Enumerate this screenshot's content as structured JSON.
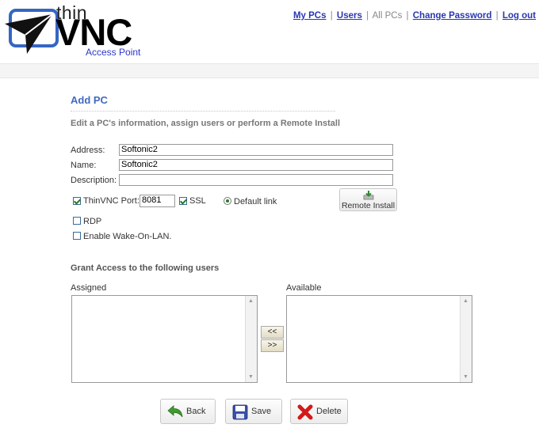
{
  "logo": {
    "thin": "thin",
    "vnc": "VNC",
    "subtitle": "Access Point"
  },
  "nav": {
    "my_pcs": "My PCs",
    "sep": "|",
    "users": "Users",
    "all_pcs": "All PCs",
    "change_password": "Change Password",
    "log_out": "Log out"
  },
  "form": {
    "title": "Add PC",
    "subtitle": "Edit a PC's information, assign users or perform a Remote Install",
    "address_label": "Address:",
    "address_value": "Softonic2",
    "name_label": "Name:",
    "name_value": "Softonic2",
    "description_label": "Description:",
    "description_value": "",
    "thinvnc_port_label": "ThinVNC Port:",
    "thinvnc_port_value": "8081",
    "thinvnc_checked": true,
    "ssl_label": "SSL",
    "ssl_checked": true,
    "default_link_label": "Default link",
    "rdp_label": "RDP",
    "rdp_checked": false,
    "wol_label": "Enable Wake-On-LAN.",
    "wol_checked": false,
    "remote_install_label": "Remote Install"
  },
  "grant": {
    "title": "Grant Access to the following users",
    "assigned_label": "Assigned",
    "available_label": "Available",
    "assigned_items": [],
    "available_items": [],
    "move_left_label": "<<",
    "move_right_label": ">>"
  },
  "actions": {
    "back": "Back",
    "save": "Save",
    "delete": "Delete"
  },
  "colors": {
    "link": "#2a37b0",
    "heading": "#4169c0",
    "logo_subtitle": "#2b36c8",
    "check": "#2a7a2a",
    "delete_x": "#d11a1a",
    "back_arrow": "#3f9b2f",
    "save_disk": "#3a4fa8"
  }
}
